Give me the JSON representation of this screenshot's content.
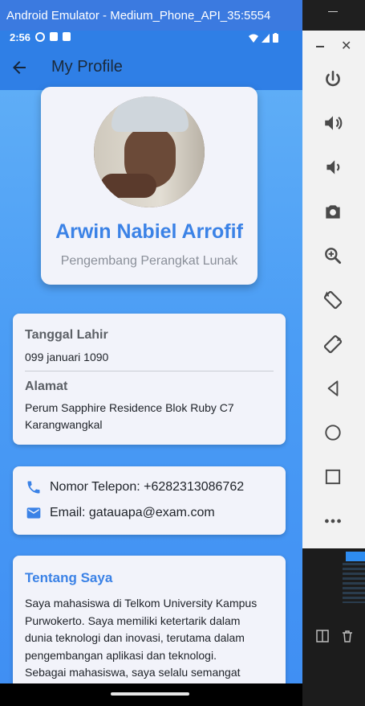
{
  "window": {
    "title": "Android Emulator - Medium_Phone_API_35:5554"
  },
  "statusbar": {
    "time": "2:56"
  },
  "appbar": {
    "title": "My Profile"
  },
  "profile": {
    "name": "Arwin Nabiel Arrofif",
    "role": "Pengembang Perangkat Lunak"
  },
  "info": {
    "birth_label": "Tanggal Lahir",
    "birth_value": "099 januari 1090",
    "address_label": "Alamat",
    "address_line1": "Perum Sapphire Residence Blok Ruby C7",
    "address_line2": "Karangwangkal"
  },
  "contact": {
    "phone": "Nomor Telepon: +6282313086762",
    "email": "Email: gatauapa@exam.com"
  },
  "about": {
    "title": "Tentang Saya",
    "lines": [
      "Saya mahasiswa di Telkom University Kampus",
      "Purwokerto. Saya memiliki ketertarik dalam",
      "dunia teknologi dan inovasi, terutama dalam",
      "pengembangan aplikasi dan teknologi.",
      "Sebagai mahasiswa, saya selalu semangat"
    ]
  },
  "colors": {
    "accent": "#3b82e6",
    "appbar": "#2f7fe6",
    "title_bar": "#3b7ae0"
  },
  "panel_icons": [
    "power-icon",
    "volume-up-icon",
    "volume-down-icon",
    "camera-icon",
    "zoom-icon",
    "rotate-left-icon",
    "rotate-right-icon",
    "back-icon",
    "home-icon",
    "overview-icon",
    "more-icon"
  ]
}
